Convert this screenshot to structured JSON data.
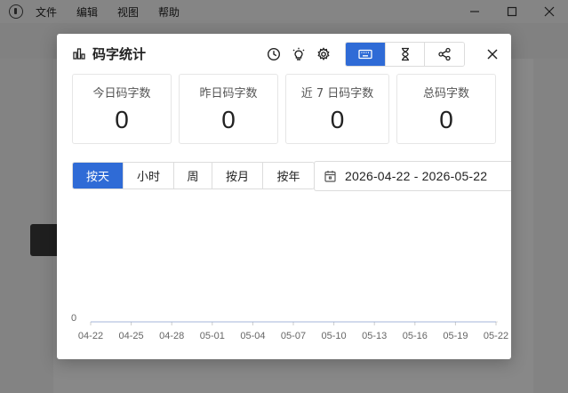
{
  "app": {
    "menu": [
      "文件",
      "编辑",
      "视图",
      "帮助"
    ]
  },
  "dialog": {
    "title": "码字统计",
    "header_icons": [
      "clock-icon",
      "bulb-icon",
      "gear-icon"
    ],
    "view_switch": {
      "items": [
        "keyboard-icon",
        "hourglass-icon",
        "share-icon"
      ],
      "active_index": 0
    },
    "stats": [
      {
        "label": "今日码字数",
        "value": "0"
      },
      {
        "label": "昨日码字数",
        "value": "0"
      },
      {
        "label": "近 7 日码字数",
        "value": "0"
      },
      {
        "label": "总码字数",
        "value": "0"
      }
    ],
    "period_tabs": {
      "items": [
        "按天",
        "小时",
        "周",
        "按月",
        "按年"
      ],
      "active_index": 0
    },
    "date_range": "2026-04-22 - 2026-05-22"
  },
  "colors": {
    "accent": "#2f6bd6",
    "overlay": "rgba(0,0,0,0.45)"
  },
  "chart_data": {
    "type": "line",
    "categories": [
      "04-22",
      "04-25",
      "04-28",
      "05-01",
      "05-04",
      "05-07",
      "05-10",
      "05-13",
      "05-16",
      "05-19",
      "05-22"
    ],
    "series": [
      {
        "values": [
          0,
          0,
          0,
          0,
          0,
          0,
          0,
          0,
          0,
          0,
          0
        ]
      }
    ],
    "y_ticks": [
      "0"
    ],
    "title": "",
    "xlabel": "",
    "ylabel": ""
  }
}
